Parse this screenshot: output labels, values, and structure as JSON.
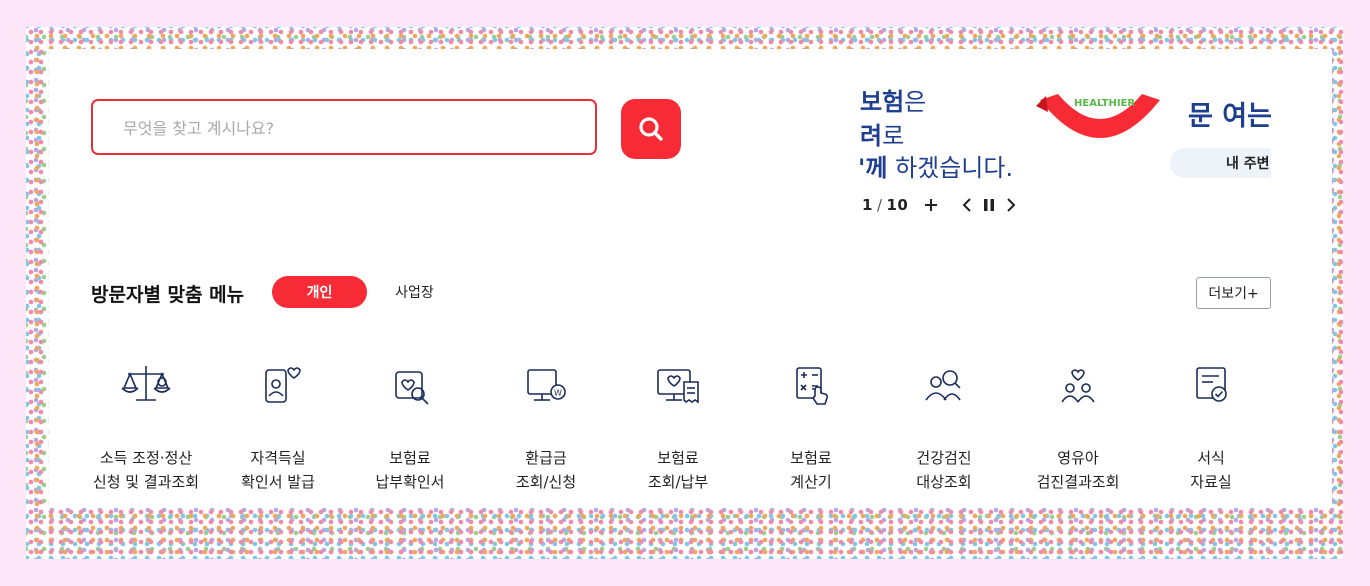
{
  "search": {
    "placeholder": "무엇을 찾고 계시나요?"
  },
  "banner": {
    "line1_bold": "보험",
    "line1_light": "은",
    "line2_bold": "려",
    "line2_light": "로",
    "line3_bold": "'께",
    "line3_light": " 하겠습니다.",
    "healthier_text": "HEALTHIER",
    "right_title": "문 여는",
    "my_pill": "내 주변"
  },
  "slider": {
    "current": "1",
    "sep": "/",
    "total": "10"
  },
  "section": {
    "title": "방문자별 맞춤 메뉴",
    "tab_personal": "개인",
    "tab_business": "사업장",
    "more": "더보기+"
  },
  "menu": [
    {
      "icon": "scale-icon",
      "line1": "소득 조정·정산",
      "line2": "신청 및 결과조회"
    },
    {
      "icon": "id-card-heart-icon",
      "line1": "자격득실",
      "line2": "확인서 발급"
    },
    {
      "icon": "heart-search-icon",
      "line1": "보험료",
      "line2": "납부확인서"
    },
    {
      "icon": "monitor-won-icon",
      "line1": "환급금",
      "line2": "조회/신청"
    },
    {
      "icon": "monitor-heart-receipt-icon",
      "line1": "보험료",
      "line2": "조회/납부"
    },
    {
      "icon": "calculator-hand-icon",
      "line1": "보험료",
      "line2": "계산기"
    },
    {
      "icon": "people-search-icon",
      "line1": "건강검진",
      "line2": "대상조회"
    },
    {
      "icon": "family-heart-icon",
      "line1": "영유아",
      "line2": "검진결과조회"
    },
    {
      "icon": "document-check-icon",
      "line1": "서식",
      "line2": "자료실"
    }
  ],
  "colors": {
    "accent": "#f72b35",
    "navy": "#1e3f8f",
    "border_pink": "#fde6f7"
  }
}
